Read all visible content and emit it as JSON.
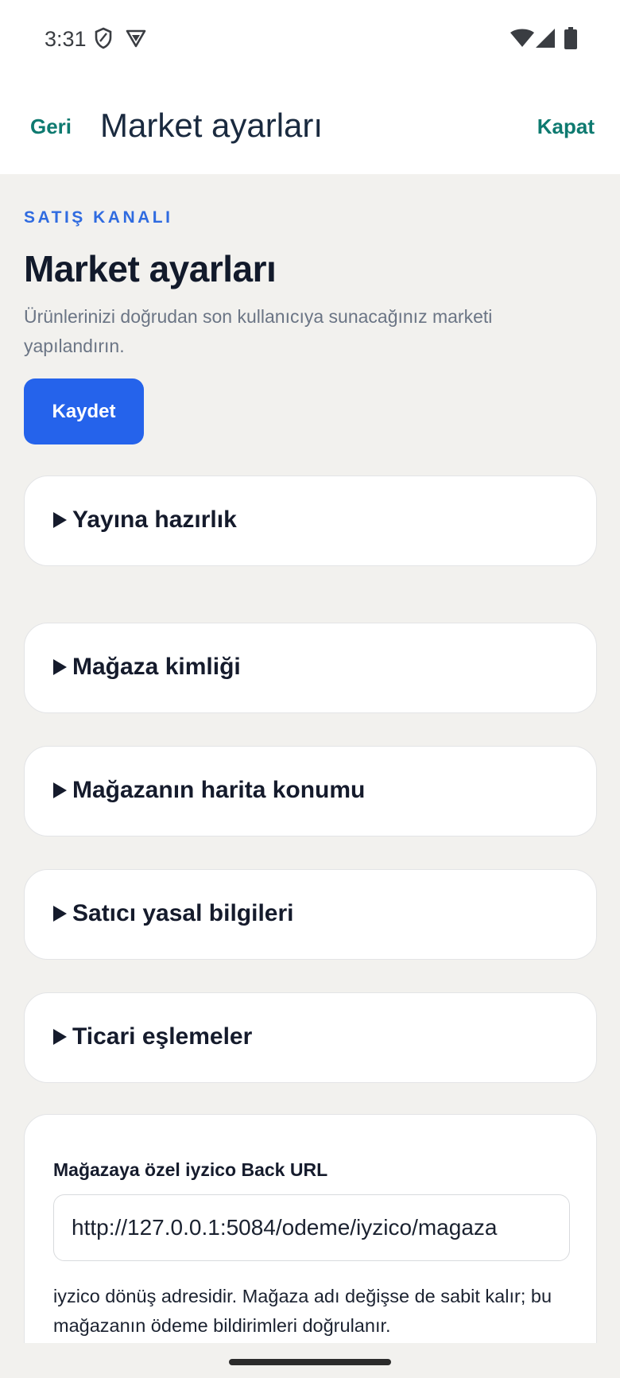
{
  "status_bar": {
    "time": "3:31",
    "icons": [
      "shield-icon",
      "vpn-icon",
      "wifi-icon",
      "signal-icon",
      "battery-icon"
    ]
  },
  "app_bar": {
    "back_label": "Geri",
    "title": "Market ayarları",
    "close_label": "Kapat"
  },
  "page": {
    "eyebrow": "SATIŞ KANALI",
    "heading": "Market ayarları",
    "subtitle": "Ürünlerinizi doğrudan son kullanıcıya sunacağınız marketi yapılandırın.",
    "save_label": "Kaydet"
  },
  "sections": [
    {
      "label": "Yayına hazırlık"
    },
    {
      "label": "Mağaza kimliği"
    },
    {
      "label": "Mağazanın harita konumu"
    },
    {
      "label": "Satıcı yasal bilgileri"
    },
    {
      "label": "Ticari eşlemeler"
    }
  ],
  "back_url": {
    "label": "Mağazaya özel iyzico Back URL",
    "value": "http://127.0.0.1:5084/odeme/iyzico/magaza",
    "help": "iyzico dönüş adresidir. Mağaza adı değişse de sabit kalır; bu mağazanın ödeme bildirimleri doğrulanır."
  },
  "colors": {
    "accent": "#2563eb",
    "teal_link": "#0e7a70",
    "background": "#f2f1ee"
  }
}
